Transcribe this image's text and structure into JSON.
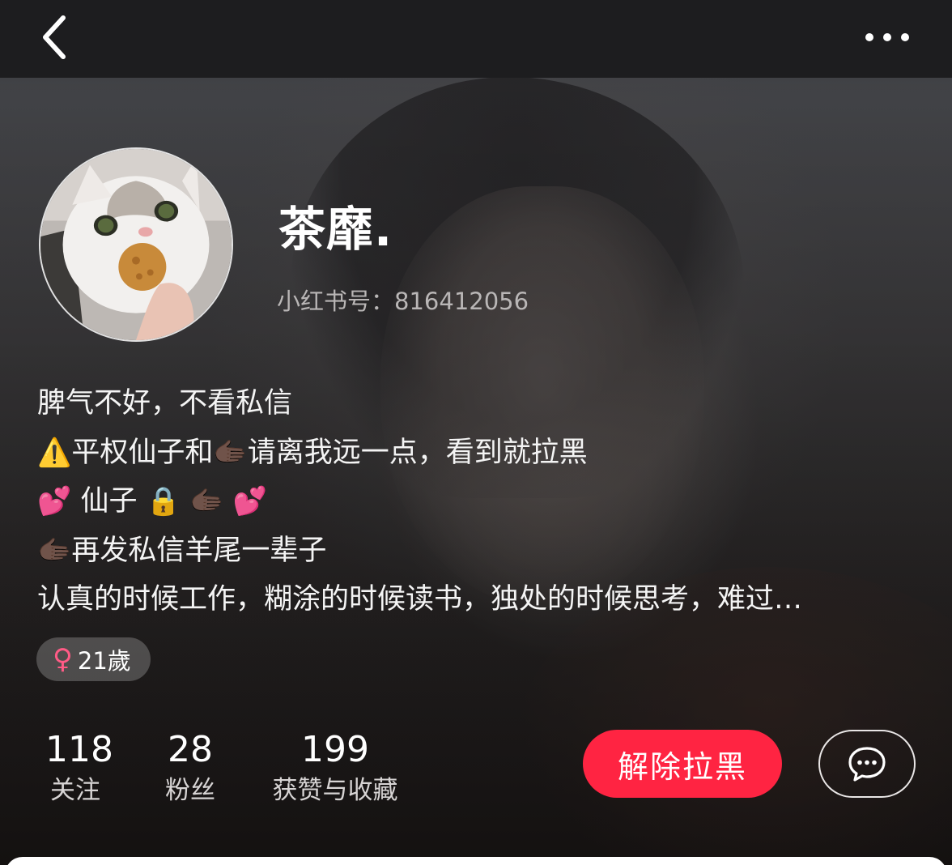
{
  "profile": {
    "nickname": "茶靡.",
    "red_id_label": "小红书号：",
    "red_id": "816412056",
    "bio_lines": [
      {
        "text": "脾气不好，不看私信"
      },
      {
        "prefix_emoji": "⚠️",
        "text": "平权仙子和",
        "mid_emoji": "🫱🏿",
        "text2": "请离我远一点，看到就拉黑"
      },
      {
        "emoji_a": "💕",
        "text": "仙子",
        "emoji_b": "🔒",
        "emoji_c": "🫱🏿",
        "emoji_d": "💕"
      },
      {
        "prefix_emoji": "🫱🏿",
        "text": "再发私信羊尾一辈子"
      },
      {
        "text": "认真的时候工作，糊涂的时候读书，独处的时候思考，难过…"
      }
    ],
    "tag": {
      "icon": "female-symbol-icon",
      "symbol": "♀",
      "label": "21歲",
      "icon_color": "#ff5b86"
    }
  },
  "stats": [
    {
      "value": "118",
      "label": "关注"
    },
    {
      "value": "28",
      "label": "粉丝"
    },
    {
      "value": "199",
      "label": "获赞与收藏"
    }
  ],
  "actions": {
    "unblock_label": "解除拉黑",
    "unblock_color": "#ff2442",
    "chat_icon": "chat-bubble-icon"
  },
  "nav": {
    "back_icon": "chevron-left-icon",
    "more_icon": "more-dots-icon"
  }
}
